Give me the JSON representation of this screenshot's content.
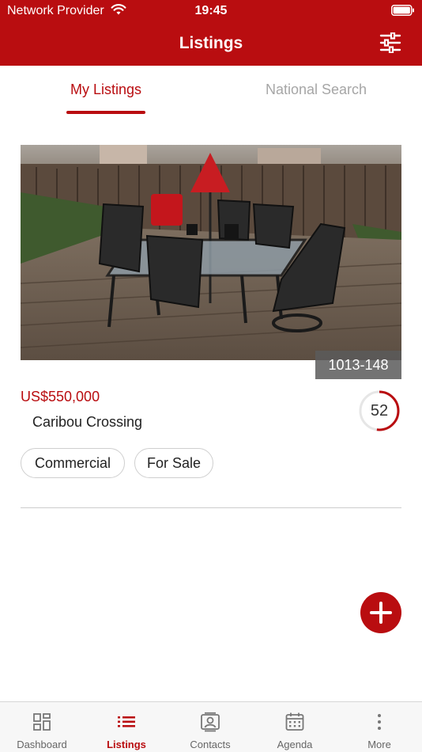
{
  "status_bar": {
    "carrier": "Network Provider",
    "time": "19:45"
  },
  "header": {
    "title": "Listings",
    "filter_icon": "sliders-icon"
  },
  "tabs": [
    {
      "label": "My Listings",
      "active": true
    },
    {
      "label": "National Search",
      "active": false
    }
  ],
  "listing": {
    "image_description": "patio-photo",
    "mls_number": "1013-148",
    "price": "US$550,000",
    "name": "Caribou Crossing",
    "score": "52",
    "score_fraction": 0.52,
    "tags": [
      "Commercial",
      "For Sale"
    ]
  },
  "fab": {
    "icon": "plus-icon"
  },
  "bottom_nav": [
    {
      "label": "Dashboard",
      "icon": "dashboard-icon",
      "active": false
    },
    {
      "label": "Listings",
      "icon": "list-icon",
      "active": true
    },
    {
      "label": "Contacts",
      "icon": "contacts-icon",
      "active": false
    },
    {
      "label": "Agenda",
      "icon": "calendar-icon",
      "active": false
    },
    {
      "label": "More",
      "icon": "more-vertical-icon",
      "active": false
    }
  ],
  "colors": {
    "accent": "#b90d10",
    "inactive_tab": "#a6a6a6",
    "nav_bg": "#f7f7f7"
  }
}
